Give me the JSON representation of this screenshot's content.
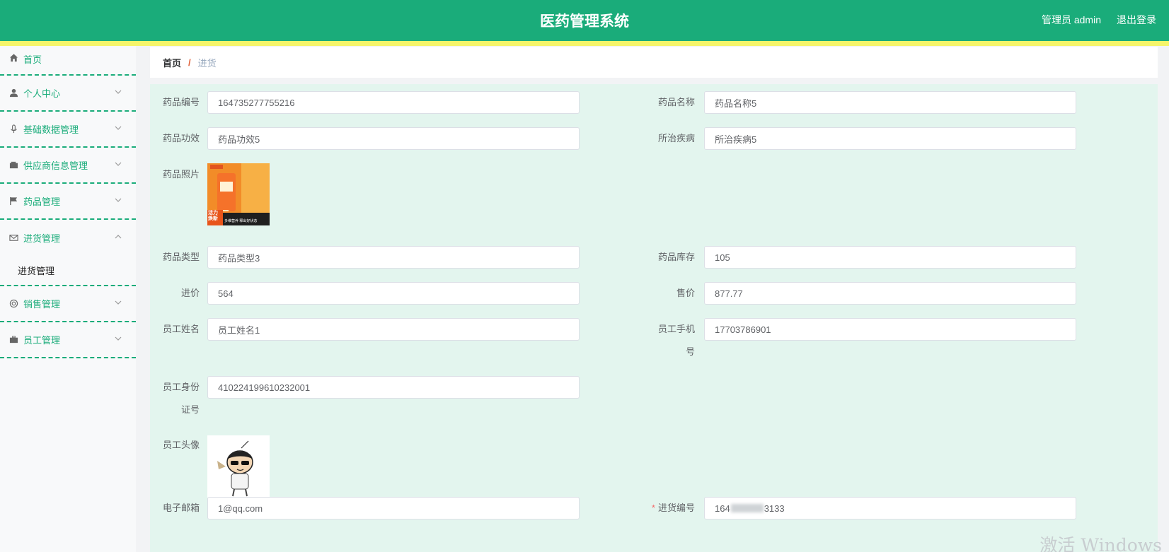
{
  "header": {
    "title": "医药管理系统",
    "admin_label": "管理员 admin",
    "logout_label": "退出登录"
  },
  "sidebar": {
    "items": [
      {
        "label": "首页",
        "icon": "home-icon"
      },
      {
        "label": "个人中心",
        "icon": "user-icon"
      },
      {
        "label": "基础数据管理",
        "icon": "microphone-icon"
      },
      {
        "label": "供应商信息管理",
        "icon": "wallet-icon"
      },
      {
        "label": "药品管理",
        "icon": "flag-icon"
      },
      {
        "label": "进货管理",
        "icon": "mail-icon"
      },
      {
        "label": "销售管理",
        "icon": "lifebuoy-icon"
      },
      {
        "label": "员工管理",
        "icon": "briefcase-icon"
      }
    ],
    "submenu": {
      "label": "进货管理"
    }
  },
  "breadcrumb": {
    "home": "首页",
    "separator": "/",
    "current": "进货"
  },
  "form": {
    "drug_code": {
      "label": "药品编号",
      "value": "164735277755216"
    },
    "drug_name": {
      "label": "药品名称",
      "value": "药品名称5"
    },
    "drug_effect": {
      "label": "药品功效",
      "value": "药品功效5"
    },
    "disease": {
      "label": "所治疾病",
      "value": "所治疾病5"
    },
    "drug_photo": {
      "label": "药品照片",
      "caption_1": "活力焕新",
      "caption_2": "多维营养 释出好状态"
    },
    "drug_type": {
      "label": "药品类型",
      "value": "药品类型3"
    },
    "stock": {
      "label": "药品库存",
      "value": "105"
    },
    "purchase_price": {
      "label": "进价",
      "value": "564"
    },
    "sale_price": {
      "label": "售价",
      "value": "877.77"
    },
    "staff_name": {
      "label": "员工姓名",
      "value": "员工姓名1"
    },
    "staff_phone": {
      "label_1": "员工手机",
      "label_2": "号",
      "value": "17703786901"
    },
    "staff_id": {
      "label_1": "员工身份",
      "label_2": "证号",
      "value": "410224199610232001"
    },
    "staff_avatar": {
      "label": "员工头像"
    },
    "email": {
      "label": "电子邮箱",
      "value": "1@qq.com"
    },
    "purchase_code": {
      "required_mark": "*",
      "label": "进货编号",
      "value": "164"
    },
    "purchase_code_tail": "3133"
  },
  "watermark": "激活 Windows",
  "colors": {
    "primary": "#1aac7a",
    "stripe": "#f5f56a",
    "form_bg": "#e3f5ee"
  }
}
